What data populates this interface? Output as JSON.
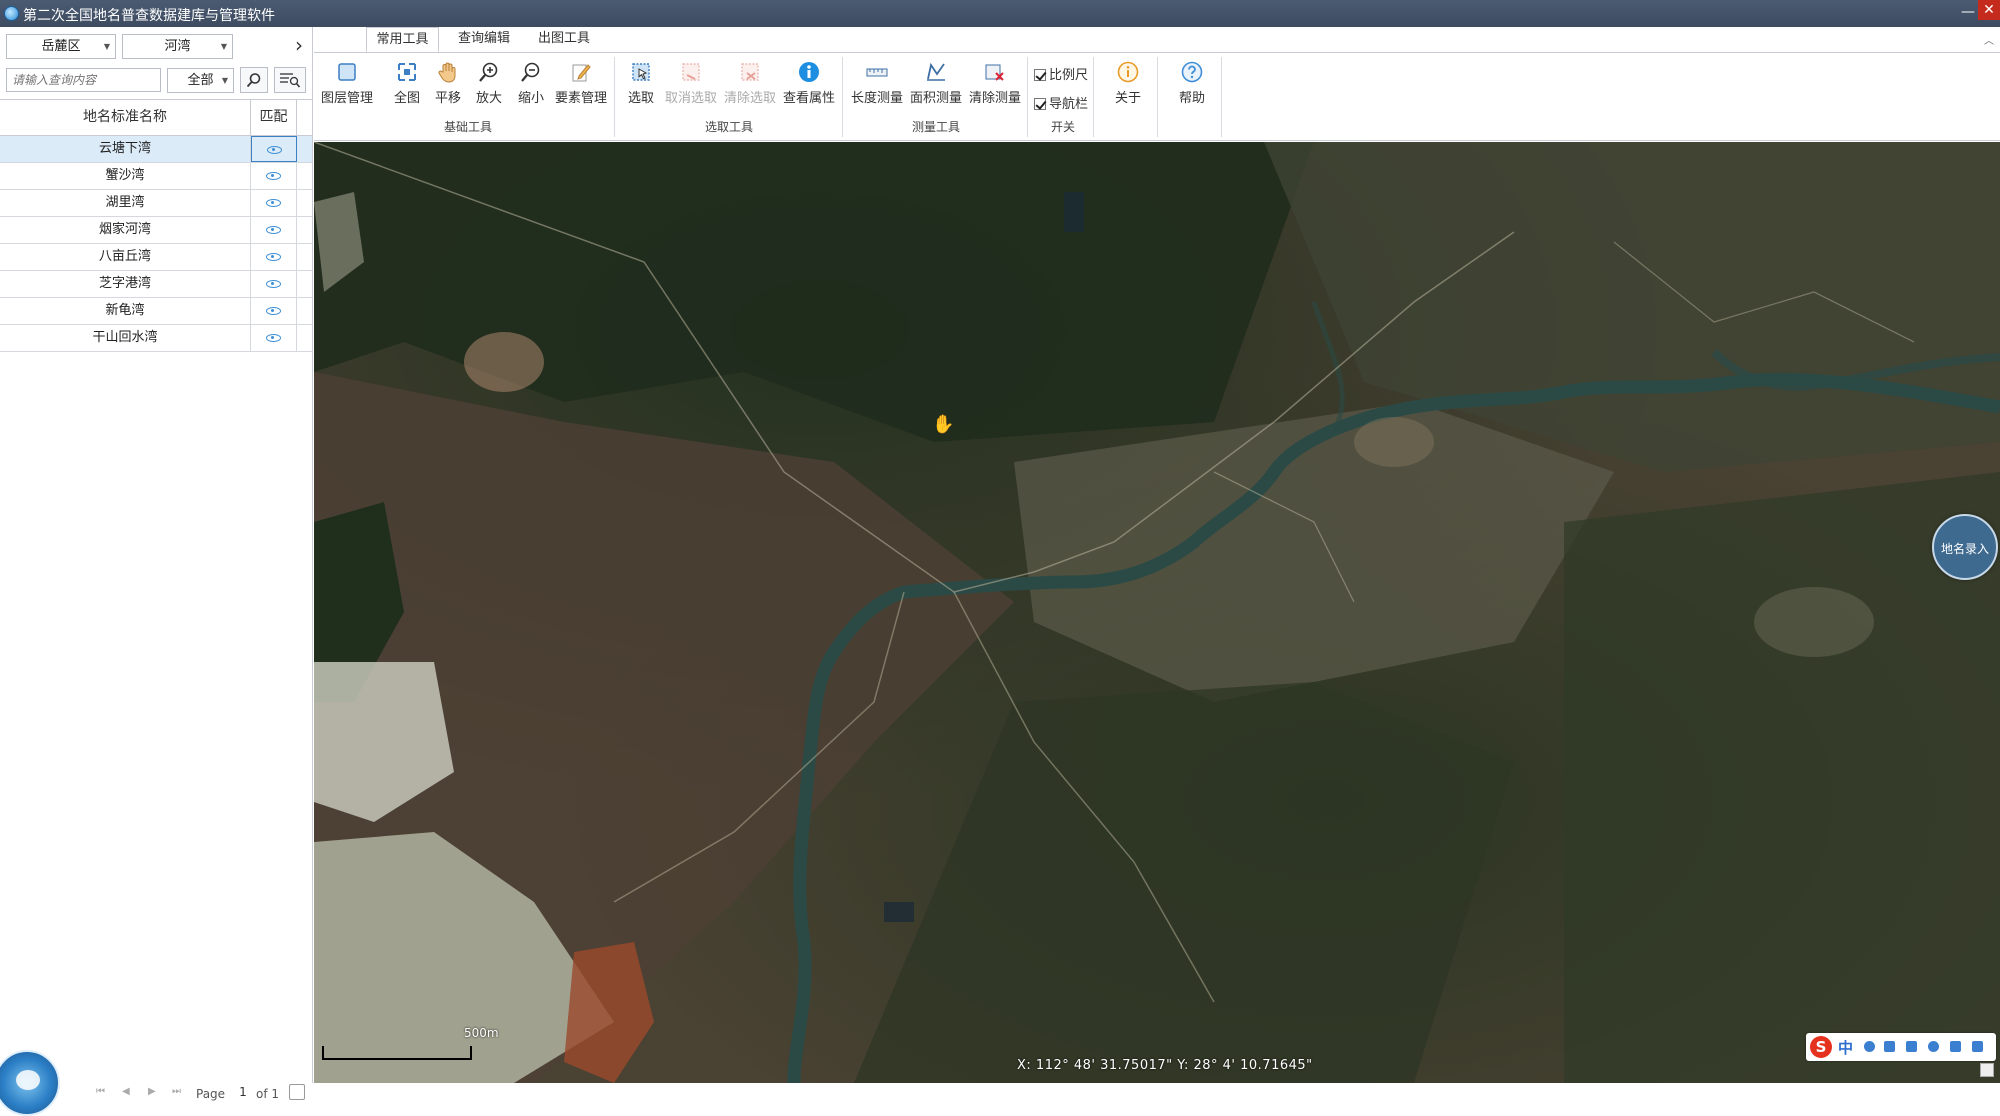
{
  "window": {
    "title": "第二次全国地名普查数据建库与管理软件",
    "minimize": "—",
    "close": "✕"
  },
  "sidebar": {
    "district_select": "岳麓区",
    "category_select": "河湾",
    "search_placeholder": "请输入查询内容",
    "scope_select": "全部",
    "table": {
      "headers": {
        "name": "地名标准名称",
        "match": "匹配"
      },
      "rows": [
        "云塘下湾",
        "蟹沙湾",
        "湖里湾",
        "烟家河湾",
        "八亩丘湾",
        "芝字港湾",
        "新龟湾",
        "干山回水湾"
      ],
      "selected_index": 0
    },
    "pager": {
      "label": "Page",
      "current": "1",
      "of": "of 1"
    }
  },
  "ribbon": {
    "tabs": [
      "常用工具",
      "查询编辑",
      "出图工具"
    ],
    "active_tab": 0,
    "buttons": {
      "layers": "图层管理",
      "full": "全图",
      "pan": "平移",
      "zoom_in": "放大",
      "zoom_out": "缩小",
      "features": "要素管理",
      "select": "选取",
      "cancel_select": "取消选取",
      "clear_select": "清除选取",
      "attributes": "查看属性",
      "length": "长度测量",
      "area": "面积测量",
      "clear_measure": "清除测量",
      "about": "关于",
      "help": "帮助"
    },
    "checkboxes": {
      "scale": "比例尺",
      "nav": "导航栏"
    },
    "groups": {
      "basic": "基础工具",
      "select": "选取工具",
      "measure": "测量工具",
      "switch": "开关"
    }
  },
  "map": {
    "entry_button": "地名录入",
    "scale_label": "500m",
    "coords": "X: 112° 48' 31.75017\"  Y: 28° 4' 10.71645\""
  },
  "ime": {
    "logo": "S",
    "mode": "中"
  },
  "colors": {
    "titlebar": "#44546a",
    "accent": "#3d8fd6",
    "close": "#c42b1c",
    "river": "#2c4a45"
  }
}
